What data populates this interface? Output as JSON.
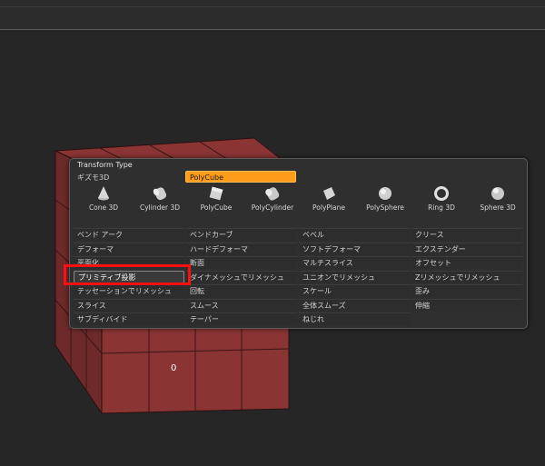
{
  "panel": {
    "title": "Transform Type",
    "gizmo_label": "ギズモ3D",
    "gizmo_value": "PolyCube"
  },
  "primitives": [
    {
      "label": "Cone 3D",
      "icon": "cone-icon"
    },
    {
      "label": "Cylinder 3D",
      "icon": "cylinder-icon"
    },
    {
      "label": "PolyCube",
      "icon": "polycube-icon"
    },
    {
      "label": "PolyCylinder",
      "icon": "polycylinder-icon"
    },
    {
      "label": "PolyPlane",
      "icon": "polyplane-icon"
    },
    {
      "label": "PolySphere",
      "icon": "polysphere-icon"
    },
    {
      "label": "Ring 3D",
      "icon": "ring-icon"
    },
    {
      "label": "Sphere 3D",
      "icon": "sphere-icon"
    }
  ],
  "ops": {
    "c0": [
      "ベンド アーク",
      "デフォーマ",
      "平面化",
      "プリミティブ投影",
      "テッセーションでリメッシュ",
      "スライス",
      "サブディバイド"
    ],
    "c1": [
      "ベンドカーブ",
      "ハードデフォーマ",
      "断面",
      "ダイナメッシュでリメッシュ",
      "回転",
      "スムース",
      "テーパー"
    ],
    "c2": [
      "ベベル",
      "ソフトデフォーマ",
      "マルチスライス",
      "ユニオンでリメッシュ",
      "スケール",
      "全体スムーズ",
      "ねじれ"
    ],
    "c3": [
      "クリース",
      "エクステンダー",
      "オフセット",
      "Zリメッシュでリメッシュ",
      "歪み",
      "伸縮"
    ]
  },
  "viewport": {
    "origin_label": "0"
  },
  "colors": {
    "accent": "#ff9d1a",
    "highlight": "#ff1010",
    "mesh": "#8a3434"
  }
}
